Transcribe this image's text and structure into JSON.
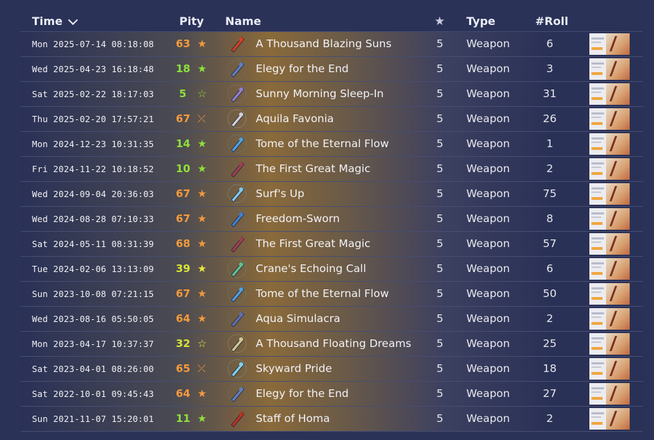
{
  "colors": {
    "background": "#2b3258",
    "pity_high": "#f39a3c",
    "pity_mid": "#d8e23a",
    "pity_low": "#8ee03a",
    "star_orange": "#f39a3c",
    "star_green": "#8ee03a",
    "star_yellow": "#e8e640"
  },
  "header": {
    "time": "Time",
    "pity": "Pity",
    "name": "Name",
    "rarity_icon": "★",
    "type": "Type",
    "roll": "#Roll"
  },
  "rows": [
    {
      "time": "Mon 2025-07-14 08:18:08",
      "pity": "63",
      "pity_level": "high",
      "pity_icon": "★",
      "pity_icon_name": "star-filled-icon",
      "item_icon": "blazing-suns-icon",
      "icon_color": "#d84020",
      "name": "A Thousand Blazing Suns",
      "rarity": "5",
      "type": "Weapon",
      "roll": "6"
    },
    {
      "time": "Wed 2025-04-23 16:18:48",
      "pity": "18",
      "pity_level": "low",
      "pity_icon": "★",
      "pity_icon_name": "star-filled-icon",
      "item_icon": "bow-icon",
      "icon_color": "#6080c0",
      "name": "Elegy for the End",
      "rarity": "5",
      "type": "Weapon",
      "roll": "3"
    },
    {
      "time": "Sat 2025-02-22 18:17:03",
      "pity": "5",
      "pity_level": "low",
      "pity_icon": "☆",
      "pity_icon_name": "star-outline-icon",
      "item_icon": "catalyst-lantern-icon",
      "icon_color": "#9080d0",
      "name": "Sunny Morning Sleep-In",
      "rarity": "5",
      "type": "Weapon",
      "roll": "31"
    },
    {
      "time": "Thu 2025-02-20 17:57:21",
      "pity": "67",
      "pity_level": "high",
      "pity_icon": "⤫",
      "pity_icon_name": "lost-fifty-fifty-icon",
      "item_icon": "sword-icon",
      "icon_color": "#d0d0d8",
      "name": "Aquila Favonia",
      "rarity": "5",
      "type": "Weapon",
      "roll": "26"
    },
    {
      "time": "Mon 2024-12-23 10:31:35",
      "pity": "14",
      "pity_level": "low",
      "pity_icon": "★",
      "pity_icon_name": "star-filled-icon",
      "item_icon": "tome-icon",
      "icon_color": "#50a0e0",
      "name": "Tome of the Eternal Flow",
      "rarity": "5",
      "type": "Weapon",
      "roll": "1"
    },
    {
      "time": "Fri 2024-11-22 10:18:52",
      "pity": "10",
      "pity_level": "low",
      "pity_icon": "★",
      "pity_icon_name": "star-filled-icon",
      "item_icon": "bow-icon",
      "icon_color": "#a04050",
      "name": "The First Great Magic",
      "rarity": "5",
      "type": "Weapon",
      "roll": "2"
    },
    {
      "time": "Wed 2024-09-04 20:36:03",
      "pity": "67",
      "pity_level": "high",
      "pity_icon": "★",
      "pity_icon_name": "star-filled-icon",
      "item_icon": "catalyst-orb-icon",
      "icon_color": "#80c8e8",
      "name": "Surf's Up",
      "rarity": "5",
      "type": "Weapon",
      "roll": "75"
    },
    {
      "time": "Wed 2024-08-28 07:10:33",
      "pity": "67",
      "pity_level": "high",
      "pity_icon": "★",
      "pity_icon_name": "star-filled-icon",
      "item_icon": "sword-icon",
      "icon_color": "#4080d0",
      "name": "Freedom-Sworn",
      "rarity": "5",
      "type": "Weapon",
      "roll": "8"
    },
    {
      "time": "Sat 2024-05-11 08:31:39",
      "pity": "68",
      "pity_level": "high",
      "pity_icon": "★",
      "pity_icon_name": "star-filled-icon",
      "item_icon": "bow-icon",
      "icon_color": "#a04050",
      "name": "The First Great Magic",
      "rarity": "5",
      "type": "Weapon",
      "roll": "57"
    },
    {
      "time": "Tue 2024-02-06 13:13:09",
      "pity": "39",
      "pity_level": "mid",
      "pity_icon": "★",
      "pity_icon_name": "star-filled-icon",
      "item_icon": "catalyst-wings-icon",
      "icon_color": "#60c090",
      "name": "Crane's Echoing Call",
      "rarity": "5",
      "type": "Weapon",
      "roll": "6"
    },
    {
      "time": "Sun 2023-10-08 07:21:15",
      "pity": "67",
      "pity_level": "high",
      "pity_icon": "★",
      "pity_icon_name": "star-filled-icon",
      "item_icon": "tome-icon",
      "icon_color": "#50a0e0",
      "name": "Tome of the Eternal Flow",
      "rarity": "5",
      "type": "Weapon",
      "roll": "50"
    },
    {
      "time": "Wed 2023-08-16 05:50:05",
      "pity": "64",
      "pity_level": "high",
      "pity_icon": "★",
      "pity_icon_name": "star-filled-icon",
      "item_icon": "bow-icon",
      "icon_color": "#6070b0",
      "name": "Aqua Simulacra",
      "rarity": "5",
      "type": "Weapon",
      "roll": "2"
    },
    {
      "time": "Mon 2023-04-17 10:37:37",
      "pity": "32",
      "pity_level": "mid",
      "pity_icon": "☆",
      "pity_icon_name": "star-outline-icon",
      "item_icon": "catalyst-lamp-icon",
      "icon_color": "#d0c890",
      "name": "A Thousand Floating Dreams",
      "rarity": "5",
      "type": "Weapon",
      "roll": "25"
    },
    {
      "time": "Sat 2023-04-01 08:26:00",
      "pity": "65",
      "pity_level": "high",
      "pity_icon": "⤫",
      "pity_icon_name": "lost-fifty-fifty-icon",
      "item_icon": "sword-icon",
      "icon_color": "#80d0e8",
      "name": "Skyward Pride",
      "rarity": "5",
      "type": "Weapon",
      "roll": "18"
    },
    {
      "time": "Sat 2022-10-01 09:45:43",
      "pity": "64",
      "pity_level": "high",
      "pity_icon": "★",
      "pity_icon_name": "star-filled-icon",
      "item_icon": "bow-icon",
      "icon_color": "#6080c0",
      "name": "Elegy for the End",
      "rarity": "5",
      "type": "Weapon",
      "roll": "27"
    },
    {
      "time": "Sun 2021-11-07 15:20:01",
      "pity": "11",
      "pity_level": "low",
      "pity_icon": "★",
      "pity_icon_name": "star-filled-icon",
      "item_icon": "polearm-icon",
      "icon_color": "#c03020",
      "name": "Staff of Homa",
      "rarity": "5",
      "type": "Weapon",
      "roll": "2"
    }
  ]
}
